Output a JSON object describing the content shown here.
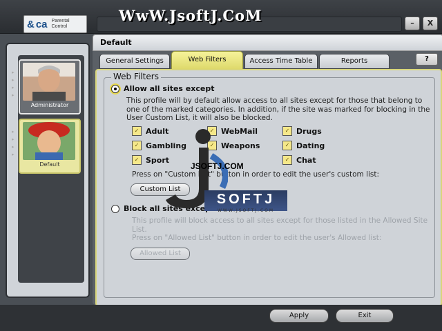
{
  "app": {
    "title_watermark": "WwW.JsoftJ.CoM",
    "logo": {
      "mark": "&",
      "brand": "ca",
      "product_line1": "Parental",
      "product_line2": "Control"
    },
    "minimize_label": "–",
    "close_label": "X"
  },
  "sidebar": {
    "profiles": [
      {
        "label": "Administrator",
        "selected": false
      },
      {
        "label": "Default",
        "selected": true
      }
    ]
  },
  "header": {
    "title": "Default",
    "help_label": "?"
  },
  "tabs": [
    {
      "label": "General Settings",
      "active": false
    },
    {
      "label": "Web Filters",
      "active": true
    },
    {
      "label": "Access Time Table",
      "active": false
    },
    {
      "label": "Reports",
      "active": false
    }
  ],
  "web_filters": {
    "group_title": "Web Filters",
    "allow_option": {
      "label": "Allow all sites except",
      "selected": true,
      "description": "This profile will by default allow access to all sites except for those that belong to one of the marked categories. In addition, if the site was marked for blocking in the User Custom List, it will also be blocked."
    },
    "categories": [
      {
        "label": "Adult",
        "checked": true
      },
      {
        "label": "WebMail",
        "checked": true
      },
      {
        "label": "Drugs",
        "checked": true
      },
      {
        "label": "Gambling",
        "checked": true
      },
      {
        "label": "Weapons",
        "checked": true
      },
      {
        "label": "Dating",
        "checked": true
      },
      {
        "label": "Sport",
        "checked": true
      },
      {
        "label": "Chat",
        "checked": true
      }
    ],
    "custom_list_hint": "Press on \"Custom List\" button in order to edit the user's custom list:",
    "custom_list_button": "Custom List",
    "block_option": {
      "label": "Block all sites except",
      "selected": false,
      "description_line1": "This profile will block access to all sites except for those listed in the Allowed Site List.",
      "description_line2": "Press on \"Allowed List\" button in order to edit the user's Allowed list:"
    },
    "allowed_list_button": "Allowed List"
  },
  "watermark": {
    "text": "JSOFTJ.COM",
    "logo_text": "SOFTJ",
    "logo_sub": "WWW.JSOFTJ.COM"
  },
  "footer": {
    "apply_label": "Apply",
    "exit_label": "Exit"
  }
}
